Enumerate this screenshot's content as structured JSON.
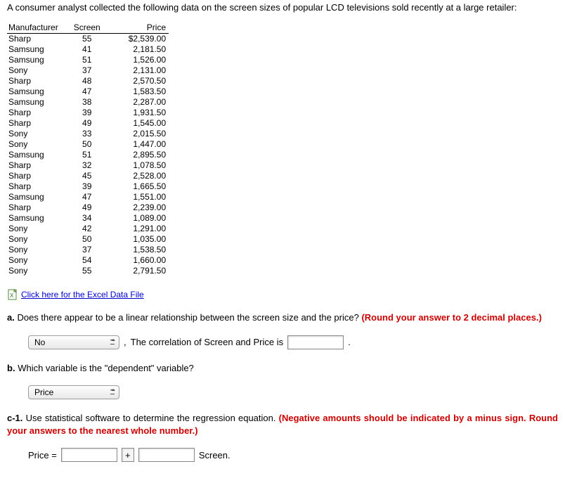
{
  "intro": "A consumer analyst collected the following data on the screen sizes of popular LCD televisions sold recently at a large retailer:",
  "table": {
    "headers": {
      "manufacturer": "Manufacturer",
      "screen": "Screen",
      "price": "Price"
    },
    "rows": [
      {
        "manufacturer": "Sharp",
        "screen": "55",
        "price": "$2,539.00"
      },
      {
        "manufacturer": "Samsung",
        "screen": "41",
        "price": "2,181.50"
      },
      {
        "manufacturer": "Samsung",
        "screen": "51",
        "price": "1,526.00"
      },
      {
        "manufacturer": "Sony",
        "screen": "37",
        "price": "2,131.00"
      },
      {
        "manufacturer": "Sharp",
        "screen": "48",
        "price": "2,570.50"
      },
      {
        "manufacturer": "Samsung",
        "screen": "47",
        "price": "1,583.50"
      },
      {
        "manufacturer": "Samsung",
        "screen": "38",
        "price": "2,287.00"
      },
      {
        "manufacturer": "Sharp",
        "screen": "39",
        "price": "1,931.50"
      },
      {
        "manufacturer": "Sharp",
        "screen": "49",
        "price": "1,545.00"
      },
      {
        "manufacturer": "Sony",
        "screen": "33",
        "price": "2,015.50"
      },
      {
        "manufacturer": "Sony",
        "screen": "50",
        "price": "1,447.00"
      },
      {
        "manufacturer": "Samsung",
        "screen": "51",
        "price": "2,895.50"
      },
      {
        "manufacturer": "Sharp",
        "screen": "32",
        "price": "1,078.50"
      },
      {
        "manufacturer": "Sharp",
        "screen": "45",
        "price": "2,528.00"
      },
      {
        "manufacturer": "Sharp",
        "screen": "39",
        "price": "1,665.50"
      },
      {
        "manufacturer": "Samsung",
        "screen": "47",
        "price": "1,551.00"
      },
      {
        "manufacturer": "Sharp",
        "screen": "49",
        "price": "2,239.00"
      },
      {
        "manufacturer": "Samsung",
        "screen": "34",
        "price": "1,089.00"
      },
      {
        "manufacturer": "Sony",
        "screen": "42",
        "price": "1,291.00"
      },
      {
        "manufacturer": "Sony",
        "screen": "50",
        "price": "1,035.00"
      },
      {
        "manufacturer": "Sony",
        "screen": "37",
        "price": "1,538.50"
      },
      {
        "manufacturer": "Sony",
        "screen": "54",
        "price": "1,660.00"
      },
      {
        "manufacturer": "Sony",
        "screen": "55",
        "price": "2,791.50"
      }
    ]
  },
  "excel_link": "Click here for the Excel Data File",
  "questions": {
    "a": {
      "label": "a.",
      "text": "Does there appear to be a linear relationship between the screen size and the price? ",
      "inst": "(Round your answer to 2 decimal places.)",
      "select_value": "No",
      "comma": ",",
      "correlation_text": "The correlation of Screen and Price is",
      "correlation_value": "",
      "period": "."
    },
    "b": {
      "label": "b.",
      "text": "Which variable is the \"dependent\" variable?",
      "select_value": "Price"
    },
    "c1": {
      "label": "c-1.",
      "text": "Use statistical software to determine the regression equation. ",
      "inst": "(Negative amounts should be indicated by a minus sign. Round your answers to the nearest whole number.)",
      "equation_label": "Price =",
      "intercept_value": "",
      "plus": "+",
      "slope_value": "",
      "unit": "Screen."
    }
  }
}
